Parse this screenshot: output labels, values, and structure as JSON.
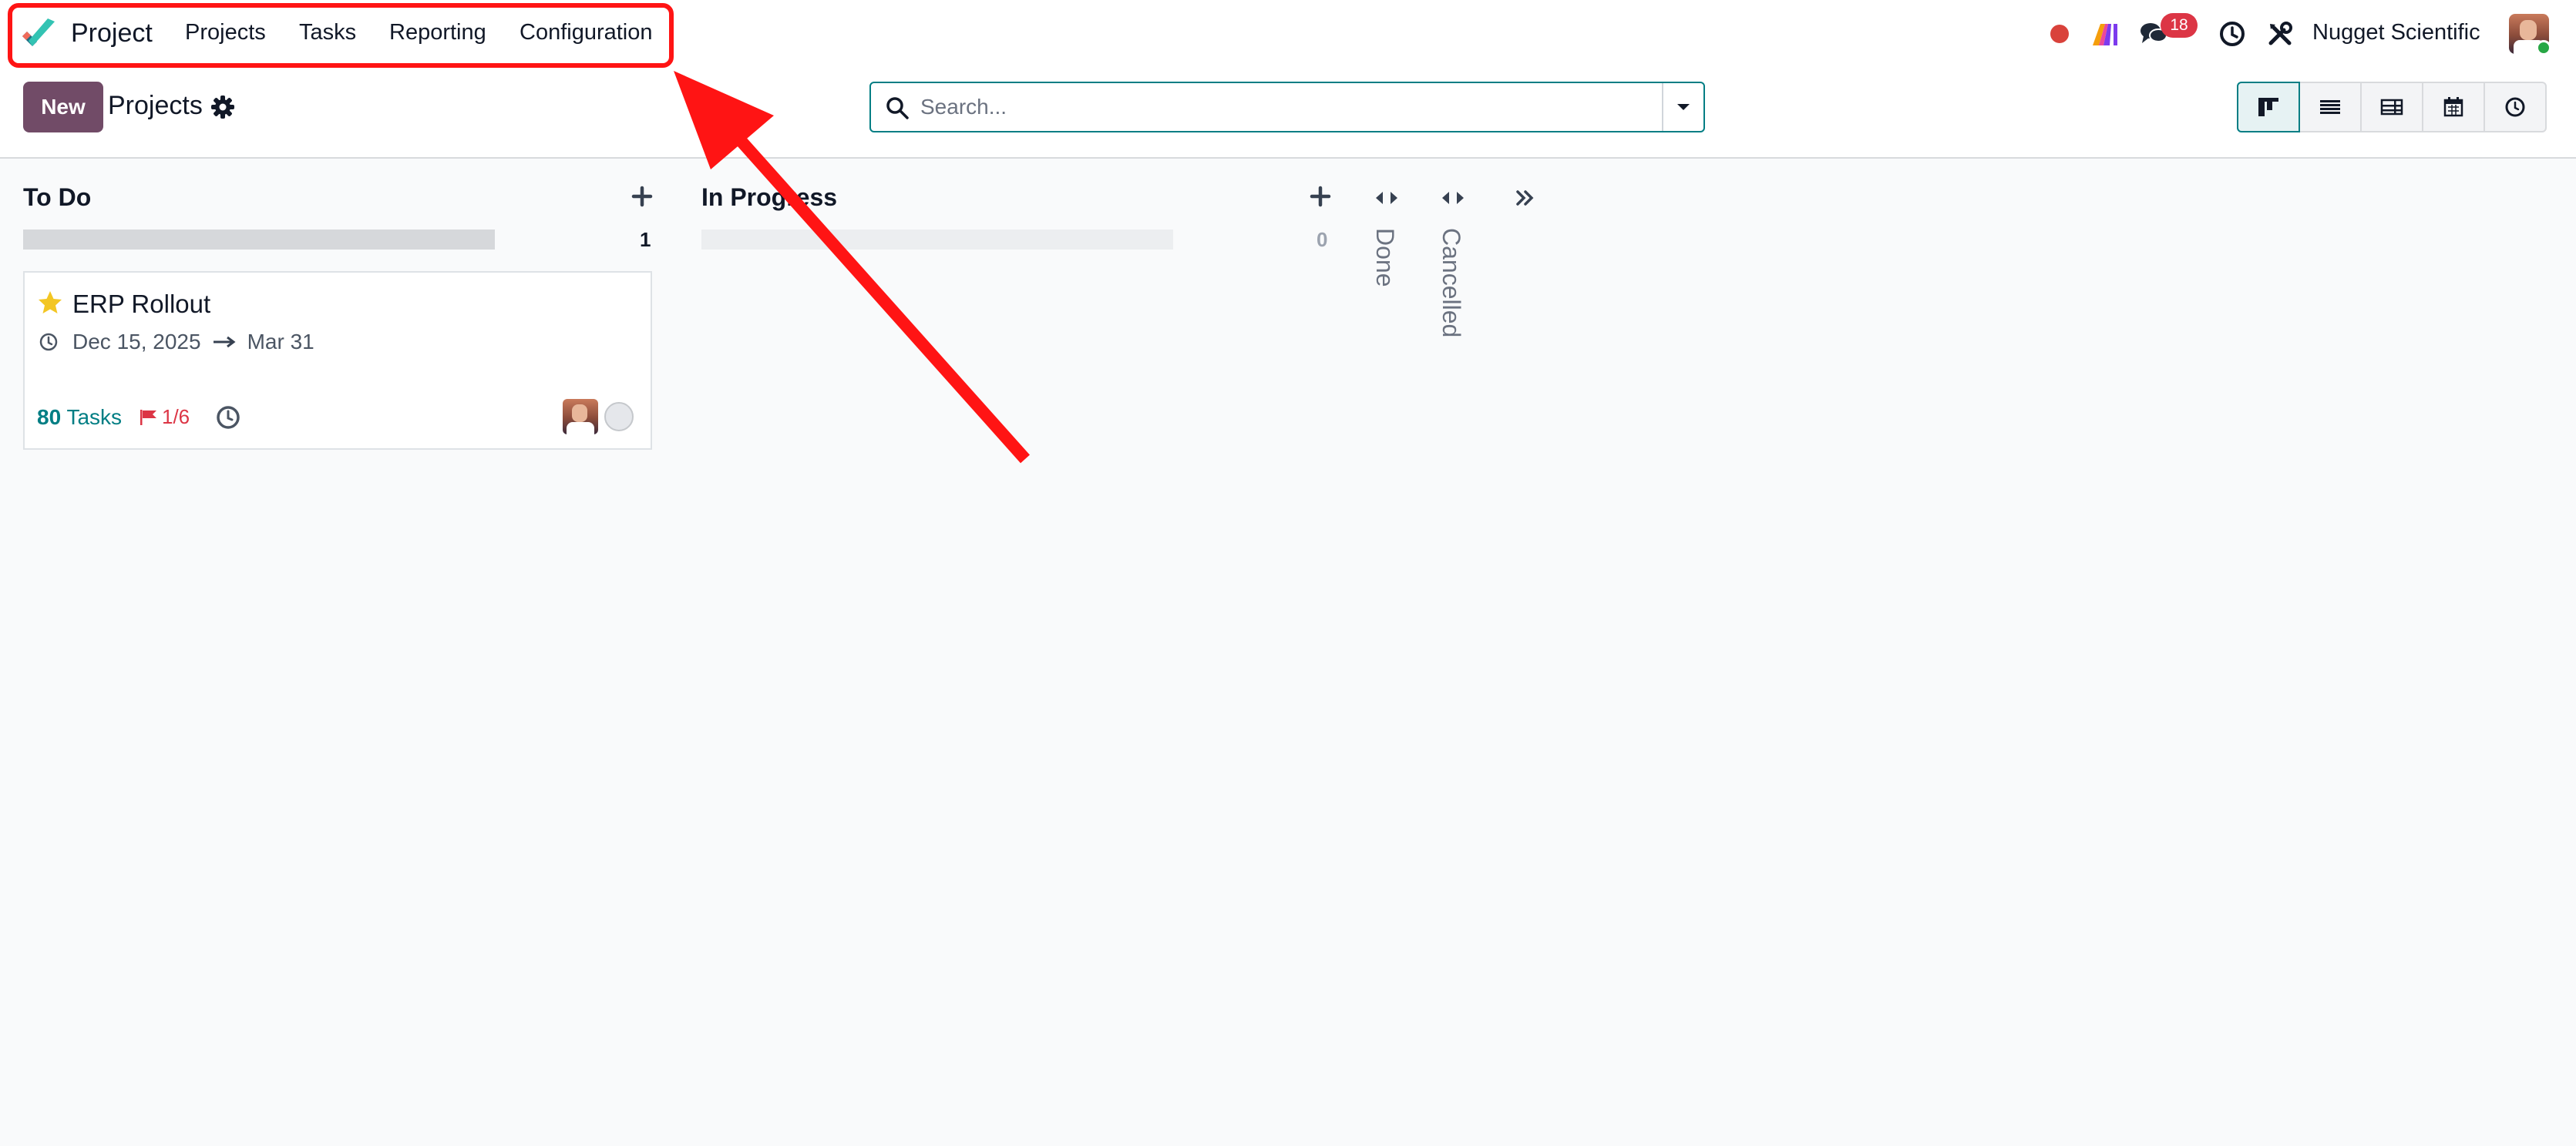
{
  "navbar": {
    "app_name": "Project",
    "menu": [
      "Projects",
      "Tasks",
      "Reporting",
      "Configuration"
    ],
    "messages_count": "18",
    "company": "Nugget Scientific"
  },
  "control_panel": {
    "new_label": "New",
    "breadcrumb": "Projects",
    "search_placeholder": "Search...",
    "views": [
      "kanban",
      "list",
      "list-detail",
      "calendar",
      "activity"
    ],
    "active_view": "kanban"
  },
  "kanban": {
    "columns": [
      {
        "title": "To Do",
        "count": "1",
        "progress": 1.0
      },
      {
        "title": "In Progress",
        "count": "0",
        "progress": 0.0
      }
    ],
    "folded_columns": [
      "Done",
      "Cancelled"
    ]
  },
  "card": {
    "title": "ERP Rollout",
    "starred": true,
    "start_date": "Dec 15, 2025",
    "end_date": "Mar 31",
    "tasks_count": "80",
    "tasks_label": "Tasks",
    "milestone": "1/6"
  },
  "colors": {
    "brand": "#714b67",
    "accent": "#017e84",
    "annotation": "#ff1414",
    "badge": "#dc3545"
  },
  "annotation": {
    "type": "arrow",
    "target": "top menu"
  }
}
